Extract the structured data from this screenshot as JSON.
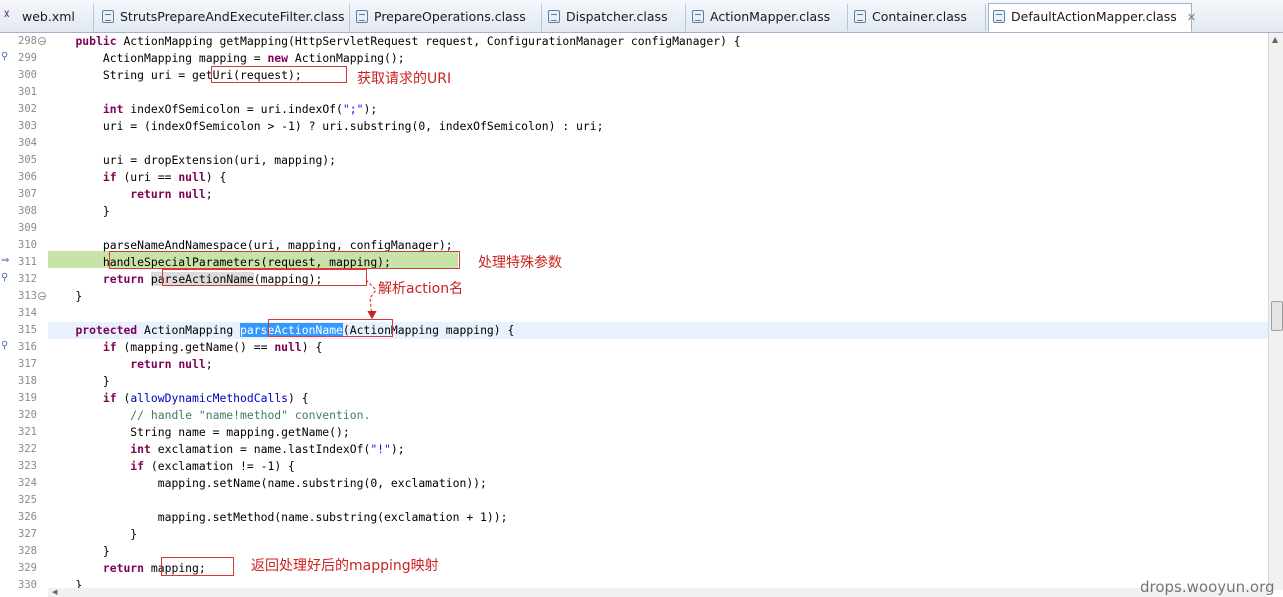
{
  "tabs": [
    {
      "label": "web.xml",
      "icon": "xml-file-icon"
    },
    {
      "label": "StrutsPrepareAndExecuteFilter.class",
      "icon": "class-file-icon"
    },
    {
      "label": "PrepareOperations.class",
      "icon": "class-file-icon"
    },
    {
      "label": "Dispatcher.class",
      "icon": "class-file-icon"
    },
    {
      "label": "ActionMapper.class",
      "icon": "class-file-icon"
    },
    {
      "label": "Container.class",
      "icon": "class-file-icon"
    },
    {
      "label": "DefaultActionMapper.class",
      "icon": "class-file-icon",
      "active": true
    }
  ],
  "line_numbers": [
    "298",
    "299",
    "300",
    "301",
    "302",
    "303",
    "304",
    "305",
    "306",
    "307",
    "308",
    "309",
    "310",
    "311",
    "312",
    "313",
    "314",
    "315",
    "316",
    "317",
    "318",
    "319",
    "320",
    "321",
    "322",
    "323",
    "324",
    "325",
    "326",
    "327",
    "328",
    "329",
    "330"
  ],
  "code": {
    "l298": [
      "    ",
      "public",
      " ActionMapping getMapping(HttpServletRequest request, ConfigurationManager configManager) {"
    ],
    "l299": [
      "        ActionMapping mapping = ",
      "new",
      " ActionMapping();"
    ],
    "l300": "        String uri = getUri(request);",
    "l302": [
      "        ",
      "int",
      " indexOfSemicolon = uri.indexOf(",
      "\";\"",
      ");"
    ],
    "l303": "        uri = (indexOfSemicolon > -1) ? uri.substring(0, indexOfSemicolon) : uri;",
    "l305": "        uri = dropExtension(uri, mapping);",
    "l306": [
      "        ",
      "if",
      " (uri == ",
      "null",
      ") {"
    ],
    "l307": [
      "            ",
      "return",
      " ",
      "null",
      ";"
    ],
    "l308": "        }",
    "l310": "        parseNameAndNamespace(uri, mapping, configManager);",
    "l311": "        handleSpecialParameters(request, mapping);",
    "l312": [
      "        ",
      "return",
      " ",
      "parseActionName",
      "(mapping);"
    ],
    "l313": "    }",
    "l315": [
      "    ",
      "protected",
      " ActionMapping ",
      "parseActionName",
      "(ActionMapping mapping) {"
    ],
    "l316": [
      "        ",
      "if",
      " (mapping.getName() == ",
      "null",
      ") {"
    ],
    "l317": [
      "            ",
      "return",
      " ",
      "null",
      ";"
    ],
    "l318": "        }",
    "l319": [
      "        ",
      "if",
      " (",
      "allowDynamicMethodCalls",
      ") {"
    ],
    "l320": "            // handle \"name!method\" convention.",
    "l321": "            String name = mapping.getName();",
    "l322": [
      "            ",
      "int",
      " exclamation = name.lastIndexOf(",
      "\"!\"",
      ");"
    ],
    "l323": [
      "            ",
      "if",
      " (exclamation != -1) {"
    ],
    "l324": "                mapping.setName(name.substring(0, exclamation));",
    "l326": "                mapping.setMethod(name.substring(exclamation + 1));",
    "l327": "            }",
    "l328": "        }",
    "l329": [
      "        ",
      "return",
      " mapping;"
    ],
    "l330": "    }"
  },
  "annotations": {
    "get_uri": "获取请求的URI",
    "special_params": "处理特殊参数",
    "parse_action": "解析action名",
    "return_mapping": "返回处理好后的mapping映射"
  },
  "watermark": "drops.wooyun.org",
  "colors": {
    "keyword": "#7f0055",
    "string": "#2a00ff",
    "comment": "#3f7f5f",
    "field": "#0000c0",
    "annotation": "#cc2222",
    "current_line": "#e8f2fe",
    "debug_line": "#c7e3a8",
    "selection": "#3399ff"
  }
}
